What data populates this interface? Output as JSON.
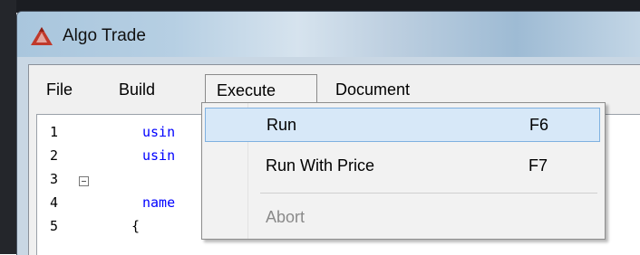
{
  "window": {
    "title": "Algo Trade",
    "app_icon": "algo-trade-logo-icon",
    "accent_color": "#c0392b"
  },
  "menubar": {
    "items": [
      {
        "label": "File"
      },
      {
        "label": "Build"
      },
      {
        "label": "Execute",
        "open": true
      },
      {
        "label": "Document"
      }
    ]
  },
  "execute_menu": {
    "items": [
      {
        "label": "Run",
        "shortcut": "F6",
        "highlighted": true,
        "enabled": true
      },
      {
        "label": "Run With Price",
        "shortcut": "F7",
        "highlighted": false,
        "enabled": true
      },
      {
        "label": "Abort",
        "shortcut": "",
        "highlighted": false,
        "enabled": false
      }
    ]
  },
  "editor": {
    "line_numbers": [
      "1",
      "2",
      "3",
      "4",
      "5"
    ],
    "visible_code": [
      "usin",
      "usin",
      "",
      "name",
      "{"
    ]
  }
}
